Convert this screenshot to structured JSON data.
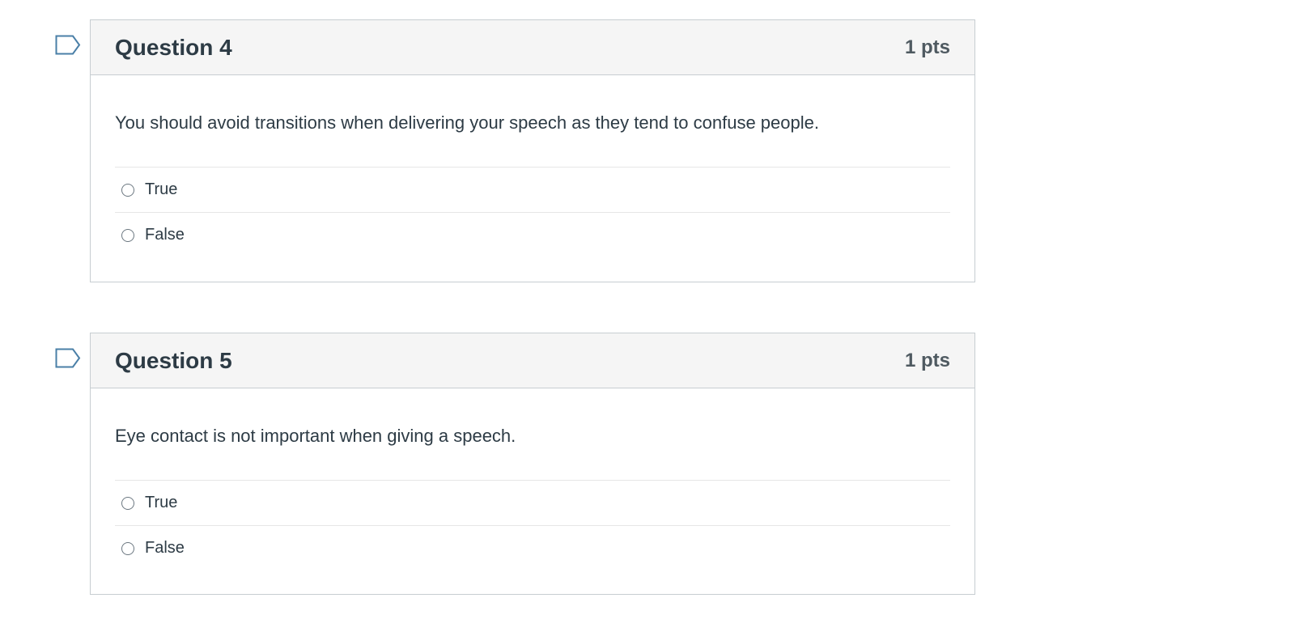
{
  "questions": [
    {
      "title": "Question 4",
      "points": "1 pts",
      "text": "You should avoid transitions when delivering your speech as they tend to confuse people.",
      "answers": [
        "True",
        "False"
      ]
    },
    {
      "title": "Question 5",
      "points": "1 pts",
      "text": "Eye contact is not important when giving a speech.",
      "answers": [
        "True",
        "False"
      ]
    }
  ],
  "colors": {
    "flag_border": "#4a7fa7",
    "header_bg": "#f5f5f5",
    "card_border": "#c7cdd1"
  },
  "icons": {
    "flag": "bookmark-flag-icon",
    "radio": "radio-unselected-icon"
  }
}
